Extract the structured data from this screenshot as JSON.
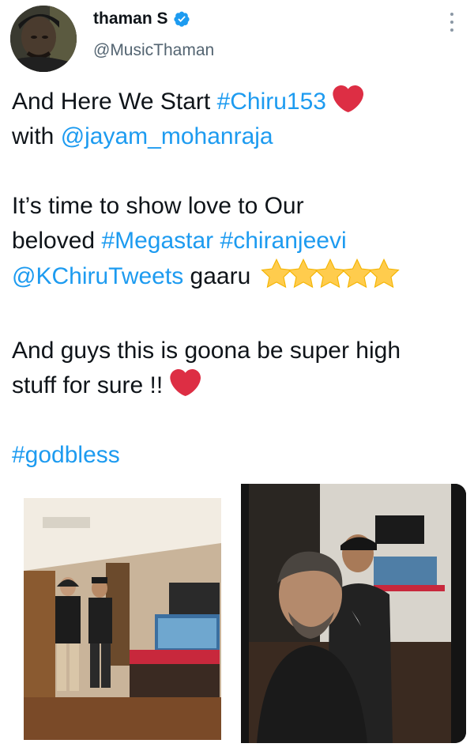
{
  "user": {
    "display_name": "thaman S",
    "handle": "@MusicThaman",
    "verified": true
  },
  "tweet": {
    "line1_text": "And Here We Start ",
    "line1_hashtag": "#Chiru153",
    "line2_text": "with ",
    "line2_mention": "@jayam_mohanraja",
    "line3_text": "It’s time to show love to Our",
    "line4_text": "beloved ",
    "line4_hashtag1": "#Megastar",
    "line4_hashtag2": "#chiranjeevi",
    "line5_mention": "@KChiruTweets",
    "line5_text": " gaaru ",
    "line6_text": "And guys this is goona be super high",
    "line7_text": "stuff for sure !! ",
    "line8_hashtag": "#godbless"
  },
  "emoji": {
    "heart": "red-heart",
    "stars": [
      "star",
      "star",
      "star",
      "star",
      "star"
    ]
  },
  "colors": {
    "link": "#1d9bf0",
    "verified_badge": "#1d9bf0",
    "text": "#0f1419",
    "secondary_text": "#536471",
    "heart": "#dd2e44",
    "star": "#ffcc4d"
  },
  "icons": {
    "verified": "verified-badge-icon",
    "more": "more-vertical-icon"
  }
}
